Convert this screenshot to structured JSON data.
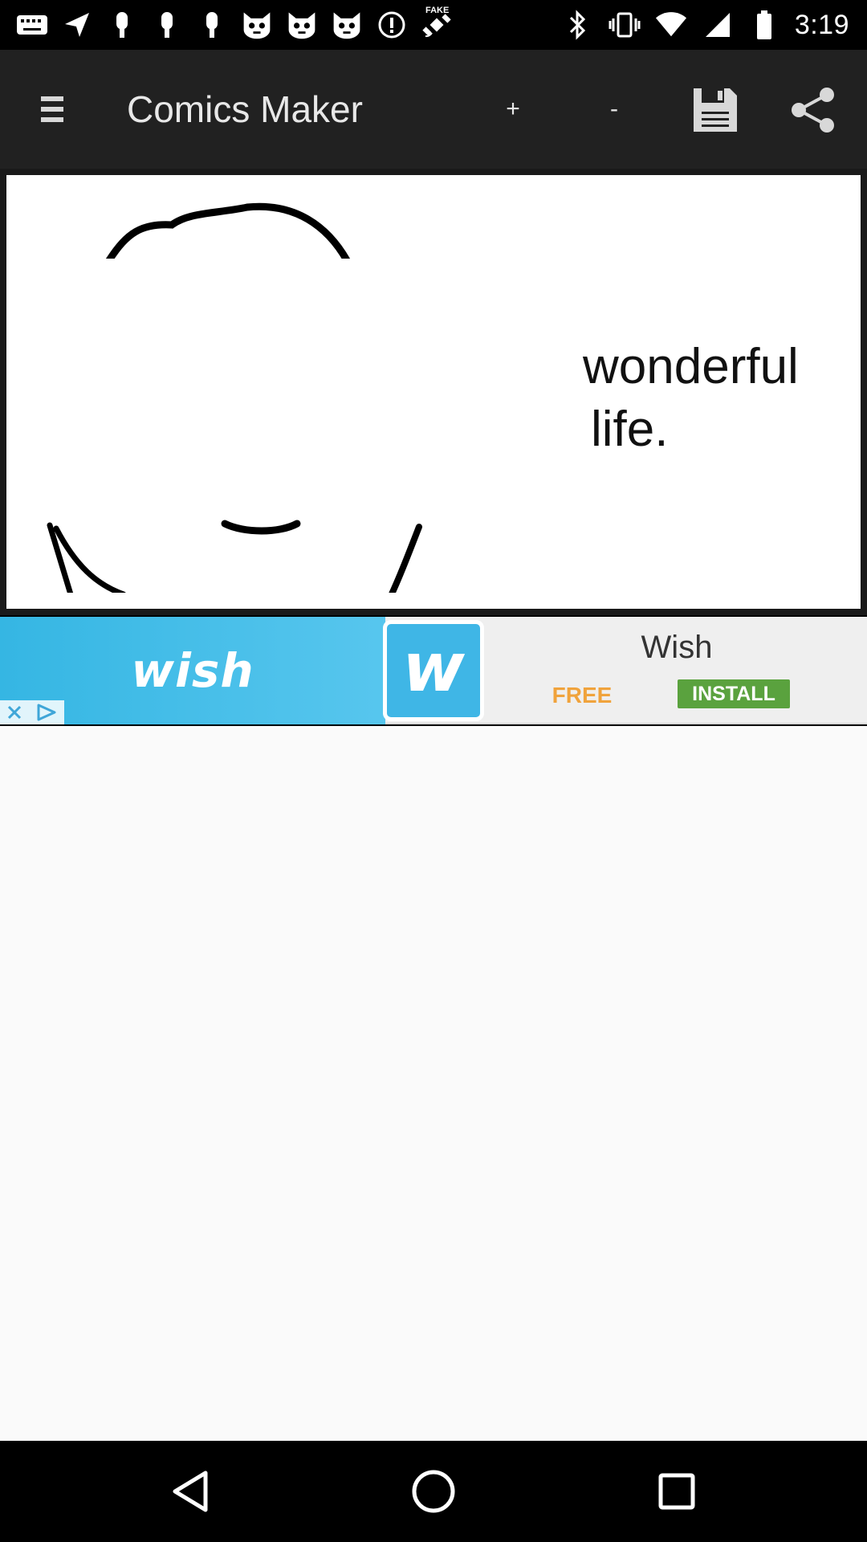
{
  "status_bar": {
    "time": "3:19",
    "left_icons": [
      "keyboard-icon",
      "navigation-arrow-icon",
      "mic-icon",
      "mic-icon",
      "mic-icon",
      "cat-face-icon",
      "cat-face-icon",
      "cat-face-icon",
      "info-circle-icon",
      "satellite-icon"
    ],
    "satellite_tag": "FAKE",
    "right_icons": [
      "bluetooth-icon",
      "vibrate-icon",
      "wifi-icon",
      "signal-icon",
      "battery-icon"
    ]
  },
  "app_bar": {
    "title": "Comics Maker",
    "plus_label": "+",
    "minus_label": "-",
    "menu_icon": "menu-icon",
    "save_icon": "save-icon",
    "share_icon": "share-icon"
  },
  "comic": {
    "caption_line1": "wonderful",
    "caption_line2": "life."
  },
  "ad": {
    "wordmark": "wish",
    "logo_letter": "w",
    "app_name": "Wish",
    "price_label": "FREE",
    "install_label": "INSTALL",
    "colors": {
      "brand": "#3fb6e6",
      "install": "#5aa23e",
      "free": "#f0a33c"
    }
  },
  "nav_bar": {
    "back_icon": "back-triangle-icon",
    "home_icon": "home-circle-icon",
    "recents_icon": "recents-square-icon"
  },
  "colors": {
    "app_bar_bg": "#212121",
    "content_bg": "#fafafa"
  }
}
